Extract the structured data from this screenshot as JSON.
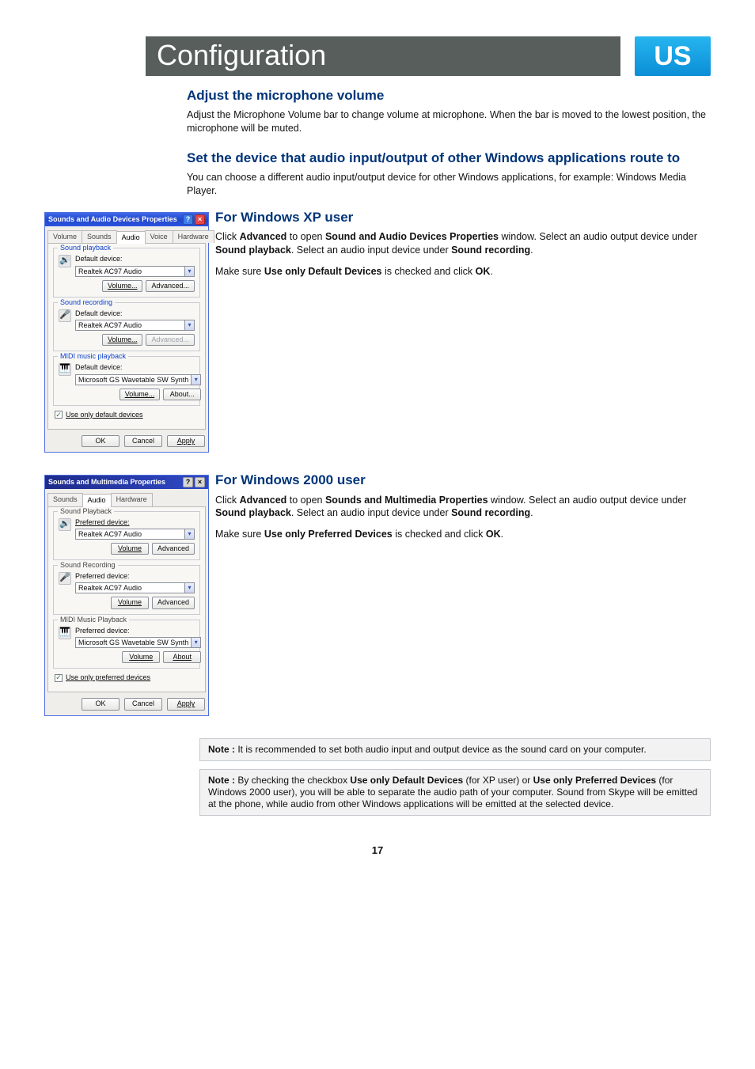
{
  "banner": {
    "title": "Configuration",
    "badge": "US"
  },
  "page_number": "17",
  "sections": {
    "adjust": {
      "heading": "Adjust the microphone volume",
      "body": "Adjust the Microphone Volume bar to change volume at microphone. When the bar is moved to the lowest position, the microphone will be muted."
    },
    "route": {
      "heading": "Set the device that audio input/output of other Windows applications route to",
      "body": "You can choose a different audio input/output device for other Windows applications, for example: Windows Media Player."
    },
    "xp": {
      "heading": "For Windows XP user",
      "p1a": "Click ",
      "p1b_bold": "Advanced",
      "p1c": " to open ",
      "p1d_bold": "Sound and Audio Devices Properties",
      "p1e": " window. Select an audio output device under ",
      "p1f_bold": "Sound playback",
      "p1g": ". Select an audio input device under ",
      "p1h_bold": "Sound recording",
      "p1i": ".",
      "p2a": "Make sure ",
      "p2b_bold": "Use only Default Devices",
      "p2c": " is checked and click ",
      "p2d_bold": "OK",
      "p2e": "."
    },
    "w2k": {
      "heading": "For Windows 2000 user",
      "p1a": "Click ",
      "p1b_bold": "Advanced",
      "p1c": " to open ",
      "p1d_bold": "Sounds and Multimedia Properties",
      "p1e": " window. Select an audio output device under ",
      "p1f_bold": "Sound playback",
      "p1g": ". Select an audio input device under ",
      "p1h_bold": "Sound recording",
      "p1i": ".",
      "p2a": "Make sure ",
      "p2b_bold": "Use only Preferred Devices",
      "p2c": " is checked and click ",
      "p2d_bold": "OK",
      "p2e": "."
    }
  },
  "notes": {
    "n1_label": "Note :",
    "n1_body": " It is recommended to set both audio input and output device as the sound card on your computer.",
    "n2_label": "Note :",
    "n2_a": " By checking the checkbox ",
    "n2_b_bold": "Use only Default Devices",
    "n2_c": " (for XP user) or ",
    "n2_d_bold": "Use only Preferred Devices",
    "n2_e": " (for Windows 2000 user), you will be able to separate the audio path of your computer. Sound from Skype will be emitted at the phone, while audio from other Windows applications will be emitted at the selected device."
  },
  "dlg_xp": {
    "title": "Sounds and Audio Devices Properties",
    "tabs": [
      "Volume",
      "Sounds",
      "Audio",
      "Voice",
      "Hardware"
    ],
    "active_tab": "Audio",
    "groups": {
      "playback": {
        "legend": "Sound playback",
        "label": "Default device:",
        "device": "Realtek AC97 Audio"
      },
      "recording": {
        "legend": "Sound recording",
        "label": "Default device:",
        "device": "Realtek AC97 Audio"
      },
      "midi": {
        "legend": "MIDI music playback",
        "label": "Default device:",
        "device": "Microsoft GS Wavetable SW Synth"
      }
    },
    "buttons": {
      "volume": "Volume...",
      "advanced": "Advanced...",
      "about": "About...",
      "ok": "OK",
      "cancel": "Cancel",
      "apply": "Apply"
    },
    "checkbox": "Use only default devices",
    "help_glyph": "?",
    "close_glyph": "×"
  },
  "dlg_w2k": {
    "title": "Sounds and Multimedia Properties",
    "tabs": [
      "Sounds",
      "Audio",
      "Hardware"
    ],
    "active_tab": "Audio",
    "groups": {
      "playback": {
        "legend": "Sound Playback",
        "label": "Preferred device:",
        "device": "Realtek AC97 Audio"
      },
      "recording": {
        "legend": "Sound Recording",
        "label": "Preferred device:",
        "device": "Realtek AC97 Audio"
      },
      "midi": {
        "legend": "MIDI Music Playback",
        "label": "Preferred device:",
        "device": "Microsoft GS Wavetable SW Synth"
      }
    },
    "buttons": {
      "volume": "Volume",
      "advanced": "Advanced",
      "about": "About",
      "ok": "OK",
      "cancel": "Cancel",
      "apply": "Apply"
    },
    "checkbox": "Use only preferred devices",
    "help_glyph": "?",
    "close_glyph": "×"
  }
}
